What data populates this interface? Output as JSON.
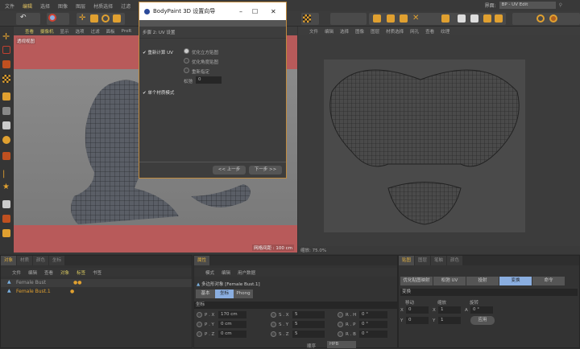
{
  "menubar": {
    "items": [
      "文件",
      "编辑",
      "选择",
      "图像",
      "图层",
      "材质选择",
      "过滤",
      "贴图"
    ],
    "interface_label": "界面:",
    "interface_value": "BP - UV Edit"
  },
  "left_viewport": {
    "menu": [
      "查看",
      "摄像机",
      "显示",
      "选项",
      "过滤",
      "面板",
      "ProR"
    ],
    "view_name": "透视视图",
    "grid_spacing": "网格间距 : 100 cm"
  },
  "uv_view": {
    "menu": [
      "文件",
      "编辑",
      "选择",
      "图像",
      "图层",
      "材质选择",
      "网孔",
      "查看",
      "纹理"
    ],
    "zoom": "缩放: 75.0%"
  },
  "dialog": {
    "title": "BodyPaint 3D 设置向导",
    "step": "步骤 2: UV 设置",
    "recalc_uv": "重新计算 UV",
    "options": [
      "优化立方贴图",
      "优化角度贴图",
      "重新指定"
    ],
    "selected_option": 0,
    "relax_label": "松弛",
    "relax_value": "0",
    "single_material": "单个材质模式",
    "back": "<< 上一步",
    "next": "下一步 >>"
  },
  "objects": {
    "tabs": [
      "对象",
      "材质",
      "颜色",
      "坐标"
    ],
    "menu": [
      "文件",
      "编辑",
      "查看",
      "对象",
      "标签",
      "书签"
    ],
    "rows": [
      {
        "name": "Female Bust",
        "active": false
      },
      {
        "name": "Female Bust.1",
        "active": true
      }
    ]
  },
  "attributes": {
    "tab": "属性",
    "menu": [
      "模式",
      "编辑",
      "用户数据"
    ],
    "object_title": "多边形对象 [Female Bust.1]",
    "subtabs": [
      "基本",
      "坐标",
      "Phong"
    ],
    "active_subtab": 1,
    "section": "坐标",
    "rows": [
      {
        "p": "P . X",
        "pv": "170 cm",
        "s": "S . X",
        "sv": "5",
        "r": "R . H",
        "rv": "0 °"
      },
      {
        "p": "P . Y",
        "pv": "0 cm",
        "s": "S . Y",
        "sv": "5",
        "r": "R . P",
        "rv": "0 °"
      },
      {
        "p": "P . Z",
        "pv": "0 cm",
        "s": "S . Z",
        "sv": "5",
        "r": "R . B",
        "rv": "0 °"
      }
    ],
    "order_label": "顺序",
    "order_value": "HPB"
  },
  "uvpanel": {
    "tabs": [
      "贴图",
      "图层",
      "笔触",
      "颜色"
    ],
    "buttons": [
      "优化贴图映射",
      "松弛 UV",
      "投射",
      "变换",
      "命令"
    ],
    "active_button": 3,
    "section": "变换",
    "move": "移动",
    "scale": "缩放",
    "rotate": "旋转",
    "mx": "0",
    "my": "0",
    "sx": "1",
    "sy": "1",
    "a": "0 °",
    "apply": "应用"
  },
  "colors": {
    "accent": "#e0a030",
    "viewport_red": "#b85a5a",
    "selected_tab": "#8aaee0"
  }
}
